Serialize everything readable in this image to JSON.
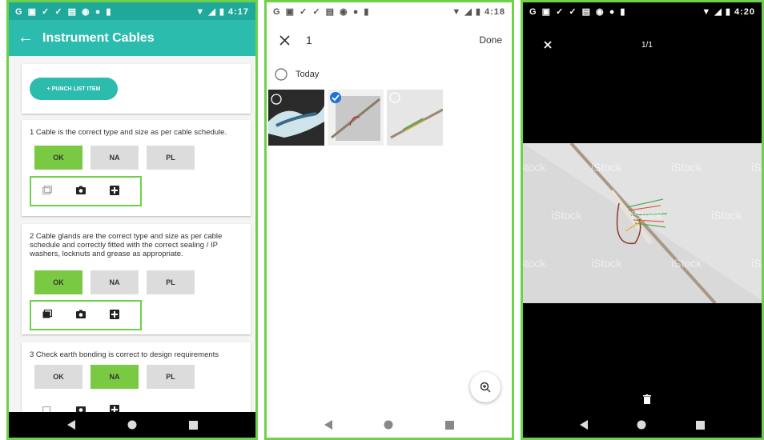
{
  "screen1": {
    "status_time": "4:17",
    "title": "Instrument Cables",
    "punch_button": "+ PUNCH LIST ITEM",
    "options": [
      "OK",
      "NA",
      "PL"
    ],
    "items": [
      {
        "text": "1 Cable is the correct type and size as per cable schedule.",
        "selected": "OK"
      },
      {
        "text": "2 Cable glands are the correct type and size as per cable schedule and correctly fitted with the correct sealing / IP washers, locknuts and grease as appropriate.",
        "selected": "OK"
      },
      {
        "text": "3 Check earth bonding is correct to design requirements",
        "selected": "NA"
      }
    ]
  },
  "screen2": {
    "status_time": "4:18",
    "count": "1",
    "done": "Done",
    "group_label": "Today"
  },
  "screen3": {
    "status_time": "4:20",
    "counter": "1/1",
    "watermark": "iStock"
  },
  "colors": {
    "teal": "#2bbcad",
    "green": "#7ac943",
    "highlight": "#6fd14a"
  }
}
